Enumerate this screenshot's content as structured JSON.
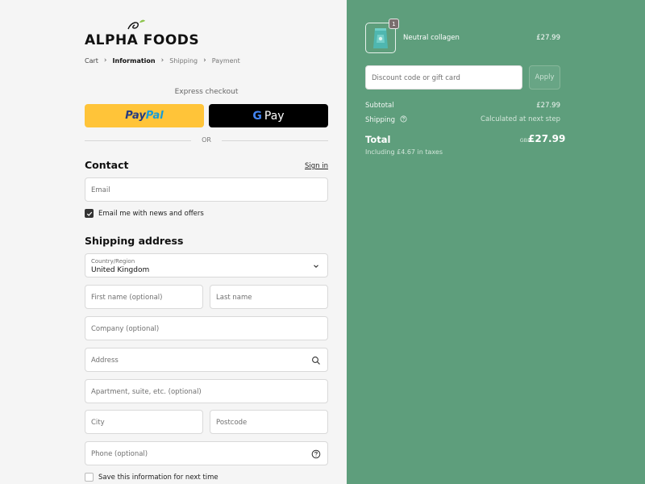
{
  "brand": {
    "logo_text": "ALPHA FOODS"
  },
  "breadcrumb": {
    "items": [
      {
        "label": "Cart",
        "state": "link"
      },
      {
        "label": "Information",
        "state": "active"
      },
      {
        "label": "Shipping",
        "state": "inactive"
      },
      {
        "label": "Payment",
        "state": "inactive"
      }
    ]
  },
  "express": {
    "label": "Express checkout",
    "paypal_part1": "Pay",
    "paypal_part2": "Pal",
    "gpay_g": "G",
    "gpay_label": "Pay",
    "or_label": "OR"
  },
  "contact": {
    "title": "Contact",
    "signin_label": "Sign in",
    "email_placeholder": "Email",
    "newsletter_label": "Email me with news and offers",
    "newsletter_checked": true
  },
  "shipping": {
    "title": "Shipping address",
    "country_label": "Country/Region",
    "country_value": "United Kingdom",
    "first_name_placeholder": "First name (optional)",
    "last_name_placeholder": "Last name",
    "company_placeholder": "Company (optional)",
    "address_placeholder": "Address",
    "apartment_placeholder": "Apartment, suite, etc. (optional)",
    "city_placeholder": "City",
    "postcode_placeholder": "Postcode",
    "phone_placeholder": "Phone (optional)",
    "save_info_label": "Save this information for next time",
    "save_info_checked": false
  },
  "order": {
    "product_name": "Neutral collagen",
    "product_price": "£27.99",
    "quantity": "1",
    "discount_placeholder": "Discount code or gift card",
    "apply_label": "Apply",
    "subtotal_label": "Subtotal",
    "subtotal_value": "£27.99",
    "shipping_label": "Shipping",
    "shipping_value": "Calculated at next step",
    "total_label": "Total",
    "currency": "GBP",
    "total_value": "£27.99",
    "taxes_note": "Including £4.67 in taxes"
  },
  "colors": {
    "summary_bg": "#5e9e7c",
    "paypal_yellow": "#ffc439",
    "gpay_black": "#000000"
  },
  "icons": {
    "country_dropdown": "chevron-down-icon",
    "address_search": "search-icon",
    "phone_help": "help-circle-icon",
    "shipping_help": "help-circle-icon",
    "newsletter_check": "check-icon"
  }
}
